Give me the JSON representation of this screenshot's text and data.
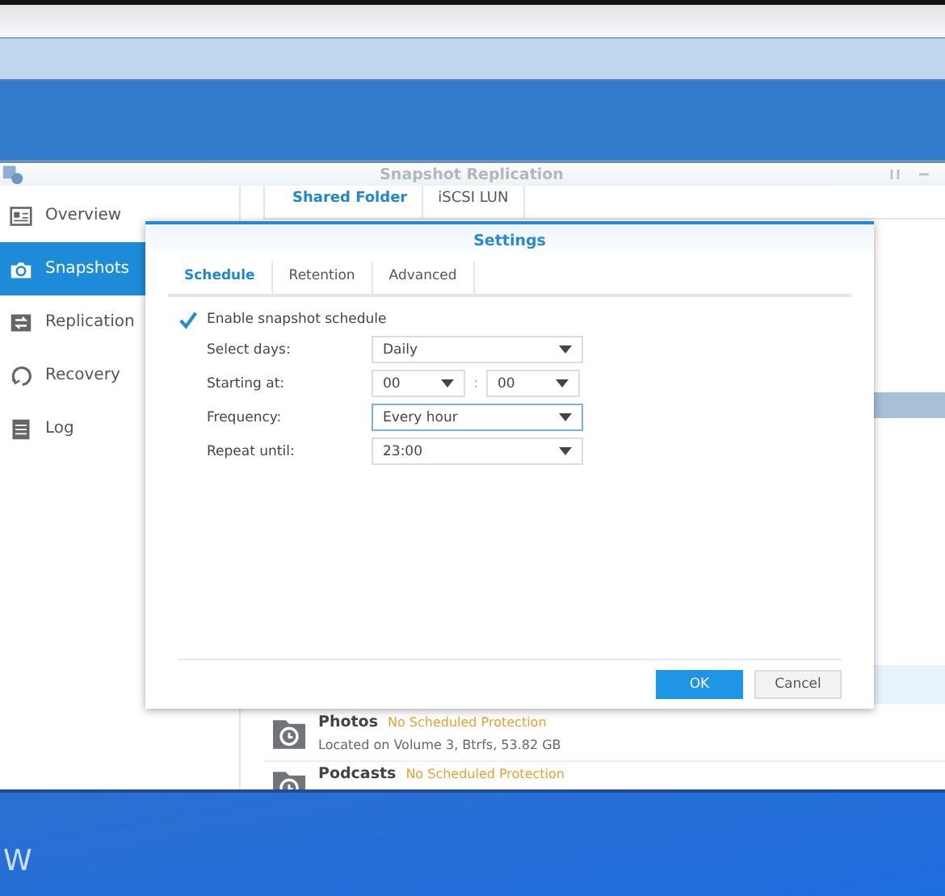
{
  "window": {
    "title": "Snapshot Replication"
  },
  "sidebar": {
    "items": [
      {
        "label": "Overview",
        "selected": false
      },
      {
        "label": "Snapshots",
        "selected": true
      },
      {
        "label": "Replication",
        "selected": false
      },
      {
        "label": "Recovery",
        "selected": false
      },
      {
        "label": "Log",
        "selected": false
      }
    ]
  },
  "content_tabs": [
    {
      "label": "Shared Folder",
      "selected": true
    },
    {
      "label": "iSCSI LUN",
      "selected": false
    }
  ],
  "folders": [
    {
      "name": "Photos",
      "status": "No Scheduled Protection",
      "detail": "Located on Volume 3, Btrfs, 53.82 GB"
    },
    {
      "name": "Podcasts",
      "status": "No Scheduled Protection"
    }
  ],
  "dialog": {
    "title": "Settings",
    "tabs": [
      {
        "label": "Schedule",
        "selected": true
      },
      {
        "label": "Retention",
        "selected": false
      },
      {
        "label": "Advanced",
        "selected": false
      }
    ],
    "enable": {
      "label": "Enable snapshot schedule",
      "checked": true
    },
    "fields": [
      {
        "label": "Select days:",
        "values": [
          "Daily"
        ],
        "focused": false
      },
      {
        "label": "Starting at:",
        "values": [
          "00",
          "00"
        ],
        "separator": ":",
        "focused": false
      },
      {
        "label": "Frequency:",
        "values": [
          "Every hour"
        ],
        "focused": true
      },
      {
        "label": "Repeat until:",
        "values": [
          "23:00"
        ],
        "focused": false
      }
    ],
    "buttons": [
      {
        "label": "OK",
        "kind": "primary"
      },
      {
        "label": "Cancel",
        "kind": "secondary"
      }
    ]
  },
  "desktop": {
    "text": "W"
  }
}
